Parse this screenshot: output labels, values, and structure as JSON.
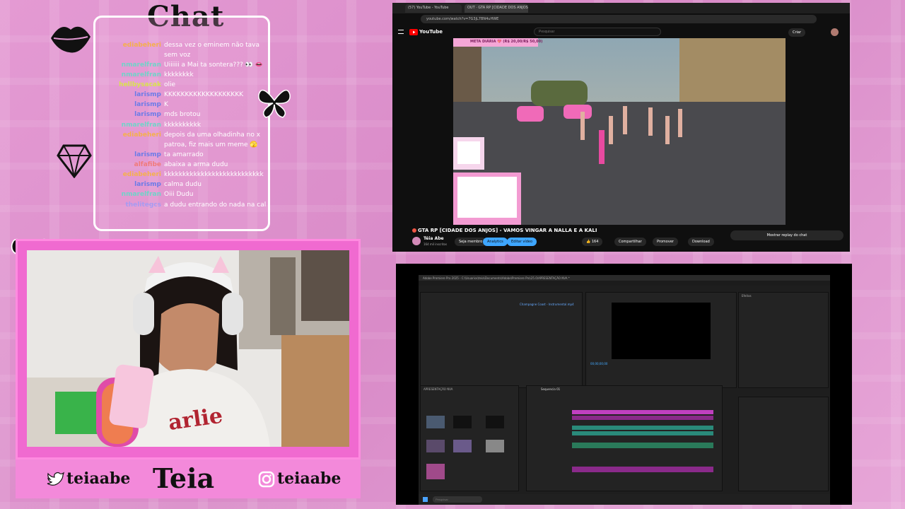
{
  "chat": {
    "title": "Chat",
    "messages": [
      {
        "user": "ediabeheri",
        "text": "dessa vez o eminem não tava sem voz",
        "color": "#f5b04c"
      },
      {
        "user": "nmarelfran",
        "text": "Uiiiiii a Mai ta sontera??? 👀 👄",
        "color": "#6fd4c8"
      },
      {
        "user": "nmarelfran",
        "text": "kkkkkkkk",
        "color": "#6fd4c8"
      },
      {
        "user": "hellbysacak",
        "text": "olie",
        "color": "#d9e34c"
      },
      {
        "user": "larismp",
        "text": "KKKKKKKKKKKKKKKKKKK",
        "color": "#6a7be8"
      },
      {
        "user": "larismp",
        "text": "K",
        "color": "#6a7be8"
      },
      {
        "user": "larismp",
        "text": "mds brotou",
        "color": "#6a7be8"
      },
      {
        "user": "nmarelfran",
        "text": "kkkkkkkkkk",
        "color": "#6fd4c8"
      },
      {
        "user": "ediabeheri",
        "text": "depois da uma olhadinha no x patroa, fiz mais um meme 🫣",
        "color": "#f5b04c"
      },
      {
        "user": "larismp",
        "text": "ta amarrado",
        "color": "#6a7be8"
      },
      {
        "user": "alfafibe",
        "text": "abaixa a arma dudu",
        "color": "#f07a7a"
      },
      {
        "user": "ediabeheri",
        "text": "kkkkkkkkkkkkkkkkkkkkkkkkkkk",
        "color": "#f5b04c"
      },
      {
        "user": "larismp",
        "text": "calma dudu",
        "color": "#6a7be8"
      },
      {
        "user": "nmarelfran",
        "text": "Oiii Dudu",
        "color": "#6fd4c8"
      },
      {
        "user": "thelitegcs",
        "text": "a dudu entrando do nada na cal",
        "color": "#a69bf2"
      }
    ]
  },
  "socials": {
    "twitter_handle": "teiaabe",
    "brand": "Teia",
    "instagram_handle": "teiaabe"
  },
  "browser": {
    "tabs": [
      "(57) YouTube - YouTube",
      "OUT · GTA RP [CIDADE DOS ANJOS]"
    ],
    "url": "youtube.com/watch?v=7G3jL7BN4uHWE",
    "search_placeholder": "Pesquisar",
    "create_label": "Criar",
    "video_title": "GTA RP [CIDADE DOS ANJOS] - VAMOS VINGAR A NALLA E A KALI",
    "channel_name": "Téia Abe",
    "subscribers": "164 mil inscritos",
    "join_label": "Seja membro",
    "analytics_label": "Analytics",
    "edit_label": "Editar vídeo",
    "likes": "164",
    "share_label": "Compartilhar",
    "promote_label": "Promover",
    "download_label": "Download",
    "chat_replay_label": "Mostrar replay do chat",
    "overlay_goal": "META DIÁRIA 💖 (R$ 20,00/R$ 50,00)"
  },
  "premiere": {
    "title_bar": "Adobe Premiere Pro 2025 - C:\\Usuarios\\teia\\Documents\\Adobe\\Premiere Pro\\25.0\\APRESENTAÇÃO NVA *",
    "panel_title": "APRESENTAÇÃO NVA",
    "sequence_tab": "Sequencia 01",
    "timecode": "00;00;00;00",
    "effects_label": "Efeitos",
    "clip_label": "Champagne Coast - Instrumental.mp4",
    "search_placeholder": "Pesquisar"
  }
}
